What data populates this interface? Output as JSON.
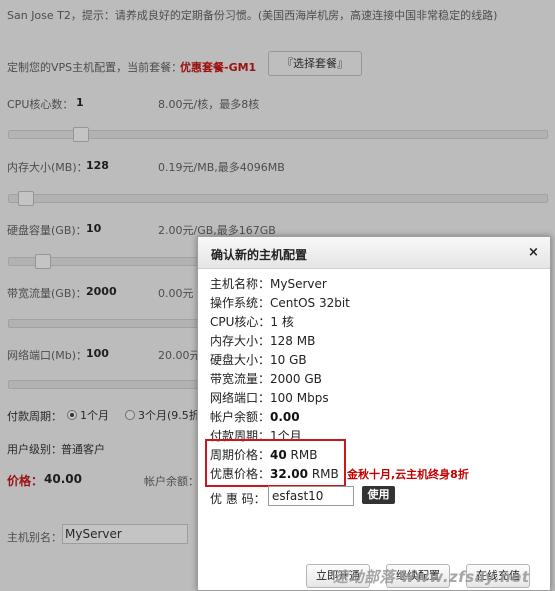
{
  "notice": "San Jose T2，提示：请养成良好的定期备份习惯。(美国西海岸机房，高速连接中国非常稳定的线路)",
  "plan": {
    "prefix": "定制您的VPS主机配置，当前套餐：",
    "name": "优惠套餐-GM1",
    "choose_button": "『选择套餐』"
  },
  "config": {
    "cpu": {
      "label": "CPU核心数：",
      "value": "1",
      "price": "8.00元/核，最多8核",
      "level": 0.125
    },
    "memory": {
      "label": "内存大小(MB)：",
      "value": "128",
      "price": "0.19元/MB,最多4096MB",
      "level": 0.03
    },
    "disk": {
      "label": "硬盘容量(GB)：",
      "value": "10",
      "price": "2.00元/GB,最多167GB",
      "level": 0.06
    },
    "bandwidth": {
      "label": "带宽流量(GB)：",
      "value": "2000",
      "price": "0.00元"
    },
    "port": {
      "label": "网络端口(Mb)：",
      "value": "100",
      "price": "20.00元"
    }
  },
  "cycle": {
    "label": "付款周期：",
    "option1": "1个月",
    "option2": "3个月(9.5折"
  },
  "user_level": {
    "label": "用户级别：",
    "value": "普通客户"
  },
  "price": {
    "label": "价格：",
    "value": "40.00",
    "balance_label": "帐户余额："
  },
  "alias": {
    "label": "主机别名：",
    "value": "MyServer"
  },
  "dialog": {
    "title": "确认新的主机配置",
    "close": "×",
    "rows": [
      {
        "label": "主机名称：",
        "value": "MyServer"
      },
      {
        "label": "操作系统：",
        "value": "CentOS 32bit"
      },
      {
        "label": "CPU核心：",
        "value": "1 核"
      },
      {
        "label": "内存大小：",
        "value": "128 MB"
      },
      {
        "label": "硬盘大小：",
        "value": "10 GB"
      },
      {
        "label": "带宽流量：",
        "value": "2000 GB"
      },
      {
        "label": "网络端口：",
        "value": "100 Mbps"
      },
      {
        "label": "帐户余额：",
        "value": "0.00"
      },
      {
        "label": "付款周期：",
        "value": "1个月"
      }
    ],
    "period_price": {
      "label": "周期价格：",
      "value": "40",
      "unit": "RMB"
    },
    "discount_price": {
      "label": "优惠价格：",
      "value": "32.00",
      "unit": "RMB"
    },
    "promo": "金秋十月,云主机终身8折",
    "coupon": {
      "label": "优 惠 码：",
      "value": "esfast10",
      "button": "使用"
    },
    "buttons": {
      "open_now": "立即开通",
      "continue_config": "继续配置",
      "recharge": "在线充值"
    }
  },
  "watermark": "速动部落 www.zfsay.net",
  "colors": {
    "accent_red": "#c40000",
    "highlight_border": "#c8171d"
  }
}
